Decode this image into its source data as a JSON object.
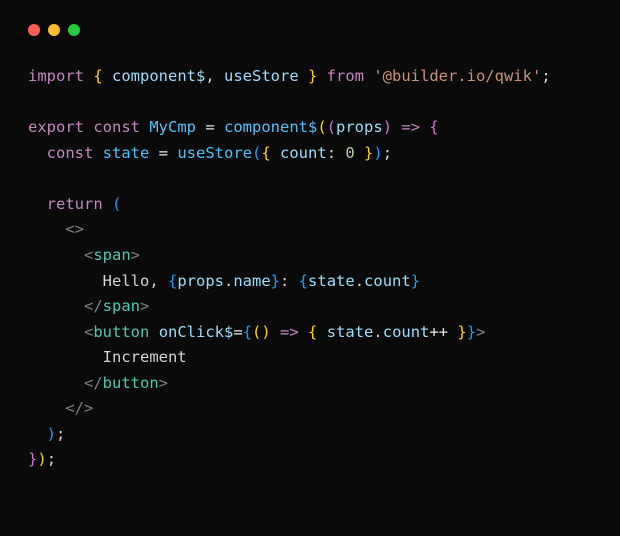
{
  "code": {
    "l1": {
      "import": "import",
      "lbrace": " { ",
      "comp": "component$",
      "comma": ", ",
      "store": "useStore",
      "rbrace": " } ",
      "from": "from",
      "sp": " ",
      "module": "'@builder.io/qwik'",
      "semi": ";"
    },
    "l2": {
      "export": "export",
      "const": " const ",
      "name": "MyCmp",
      "eq": " = ",
      "comp": "component$",
      "lparen": "(",
      "lparen2": "(",
      "props": "props",
      "rparen2": ")",
      "arrow": " => ",
      "lbrace": "{"
    },
    "l3": {
      "indent": "  ",
      "const": "const ",
      "state": "state",
      "eq": " = ",
      "fn": "useStore",
      "lparen": "(",
      "lbrace": "{ ",
      "key": "count",
      "colon": ": ",
      "val": "0",
      "rbrace": " }",
      "rparen": ")",
      "semi": ";"
    },
    "l4": {
      "indent": "  ",
      "return": "return",
      "sp": " ",
      "lparen": "("
    },
    "l5": {
      "indent": "    ",
      "open": "<>"
    },
    "l6": {
      "indent": "      ",
      "lt": "<",
      "tag": "span",
      "gt": ">"
    },
    "l7": {
      "indent": "        ",
      "txt1": "Hello, ",
      "lb1": "{",
      "expr1a": "props",
      "dot1": ".",
      "expr1b": "name",
      "rb1": "}",
      "txt2": ": ",
      "lb2": "{",
      "expr2a": "state",
      "dot2": ".",
      "expr2b": "count",
      "rb2": "}"
    },
    "l8": {
      "indent": "      ",
      "lt": "</",
      "tag": "span",
      "gt": ">"
    },
    "l9": {
      "indent": "      ",
      "lt": "<",
      "tag": "button",
      "sp": " ",
      "attr": "onClick$",
      "eq": "=",
      "lb": "{",
      "lparen": "(",
      "rparen": ")",
      "arrow": " => ",
      "lbrace": "{ ",
      "obj": "state",
      "dot": ".",
      "prop": "count",
      "op": "++",
      "rbrace": " }",
      "rb": "}",
      "gt": ">"
    },
    "l10": {
      "indent": "        ",
      "txt": "Increment"
    },
    "l11": {
      "indent": "      ",
      "lt": "</",
      "tag": "button",
      "gt": ">"
    },
    "l12": {
      "indent": "    ",
      "close": "</>"
    },
    "l13": {
      "indent": "  ",
      "rparen": ")",
      "semi": ";"
    },
    "l14": {
      "rbrace": "}",
      "rparen": ")",
      "semi": ";"
    }
  }
}
